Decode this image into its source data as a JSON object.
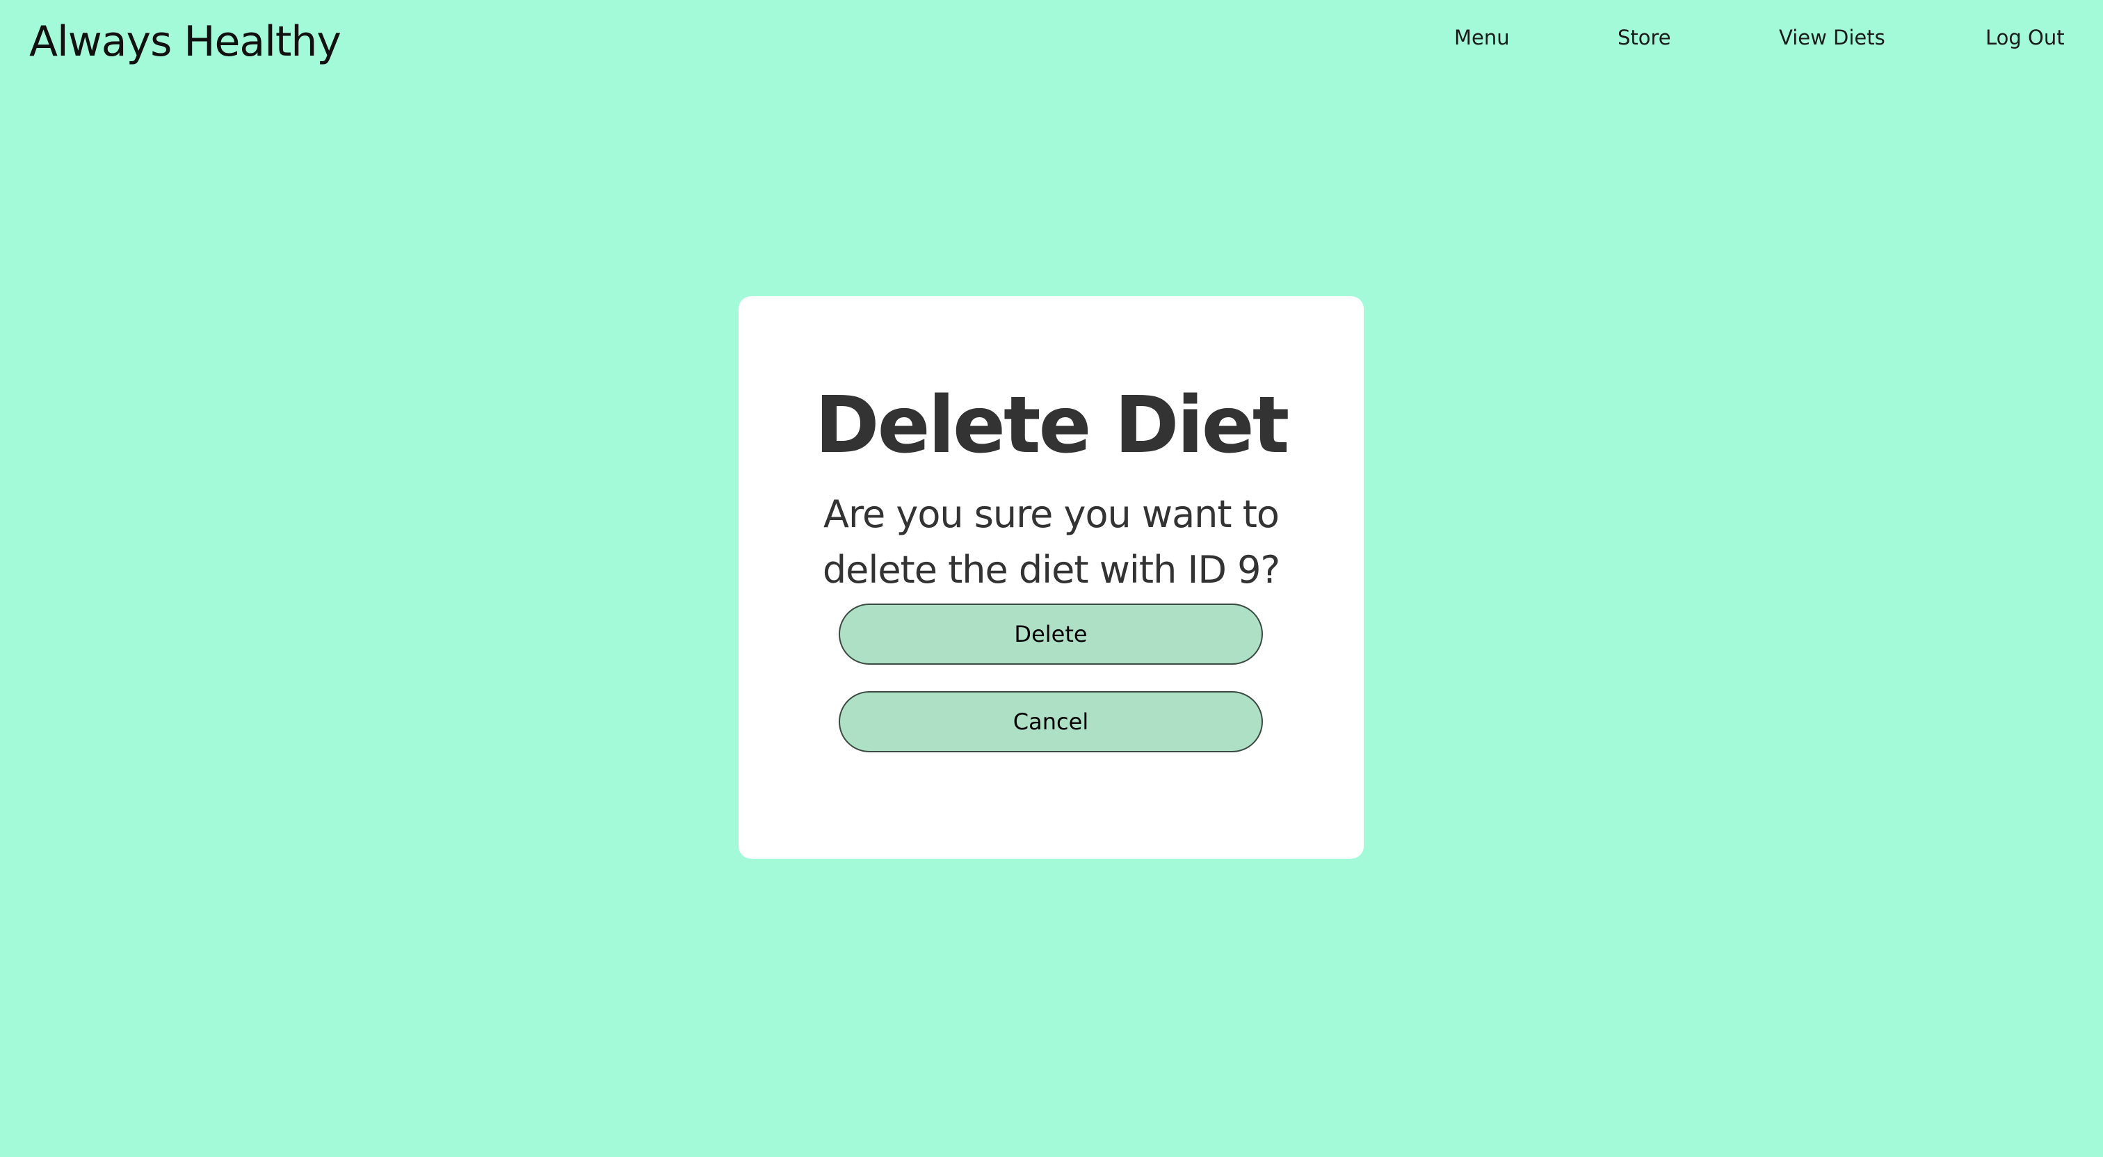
{
  "header": {
    "brand": "Always Healthy",
    "nav": {
      "menu": "Menu",
      "store": "Store",
      "view_diets": "View Diets",
      "log_out": "Log Out"
    }
  },
  "dialog": {
    "title": "Delete Diet",
    "message": "Are you sure you want to delete the diet with ID 9?",
    "delete_label": "Delete",
    "cancel_label": "Cancel"
  },
  "colors": {
    "background": "#a3fad9",
    "dialog_background": "#ffffff",
    "button_fill": "#aee0c5",
    "text_dark": "#333333"
  }
}
